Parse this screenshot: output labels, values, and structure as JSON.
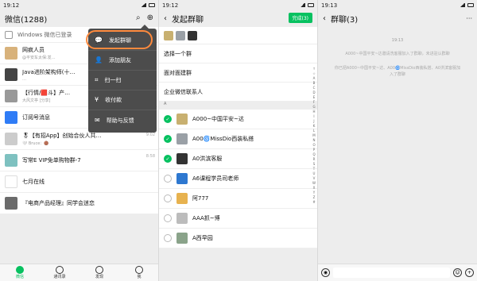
{
  "screen1": {
    "status": {
      "time": "19:12"
    },
    "header": {
      "title": "微信(1288)"
    },
    "info_row": "Windows 微信已登录",
    "chats": [
      {
        "name": "网疯人员",
        "preview": "@平安车太保:发…",
        "time": "9:14",
        "color": "#d8b27b"
      },
      {
        "name": "Java进阶架构师(十…",
        "preview": "…",
        "time": "9:10",
        "color": "#444"
      },
      {
        "name": "【行情/🟥斗】产…",
        "preview": "大风文亭 [分享]",
        "time": "9:06",
        "color": "#999"
      },
      {
        "name": "订阅号消息",
        "preview": "",
        "time": "",
        "color": "#2f7cf6"
      },
      {
        "name": "🎖【有招App】创始合伙人共…",
        "preview": "🤍 Bruce：🟤",
        "time": "9:02",
        "color": "#ccc"
      },
      {
        "name": "写常E VIP免单购物群-7",
        "preview": "",
        "time": "8:58",
        "color": "#7ec1c0"
      },
      {
        "name": "七月在线",
        "preview": "",
        "time": "",
        "color": "#fff"
      },
      {
        "name": "『电商产品经理』同学会迷恋",
        "preview": "",
        "time": "",
        "color": "#6b6b6b"
      }
    ],
    "dropdown": [
      {
        "label": "发起群聊",
        "icon": "chat-bubble-icon"
      },
      {
        "label": "添加朋友",
        "icon": "add-friend-icon"
      },
      {
        "label": "扫一扫",
        "icon": "scan-icon"
      },
      {
        "label": "收付款",
        "icon": "payment-icon"
      },
      {
        "label": "帮助与反馈",
        "icon": "mail-icon"
      }
    ],
    "tabs": [
      "微信",
      "通讯录",
      "发现",
      "我"
    ]
  },
  "screen2": {
    "status": {
      "time": "19:12"
    },
    "header": {
      "title": "发起群聊",
      "finish": "完成(3)"
    },
    "sections": [
      "选择一个群",
      "面对面建群",
      "企业微信联系人"
    ],
    "letter": "A",
    "contacts": [
      {
        "name": "A000~中国平安~达",
        "checked": true,
        "color": "#c8b070"
      },
      {
        "name": "A00🌀MissDio西装私搭",
        "checked": true,
        "color": "#9aa0a6"
      },
      {
        "name": "A0洪滨客服",
        "checked": true,
        "color": "#333"
      },
      {
        "name": "A6课程学员司老师",
        "checked": false,
        "color": "#2e78d0"
      },
      {
        "name": "阿777",
        "checked": false,
        "color": "#e7b24f"
      },
      {
        "name": "AAA抓~博",
        "checked": false,
        "color": "#bcbcbc"
      },
      {
        "name": "A西早园",
        "checked": false,
        "color": "#8aa38a"
      }
    ]
  },
  "screen3": {
    "status": {
      "time": "19:13"
    },
    "header": {
      "title": "群聊(3)"
    },
    "time": "19:13",
    "messages": [
      "A000~中国平安~达邀请洗客服加入了群聊，未进驻认群聊",
      "你已把A000~中国平安~达、A00🌀MissDio西装私搭、A0洪滨客服加入了群聊"
    ]
  }
}
